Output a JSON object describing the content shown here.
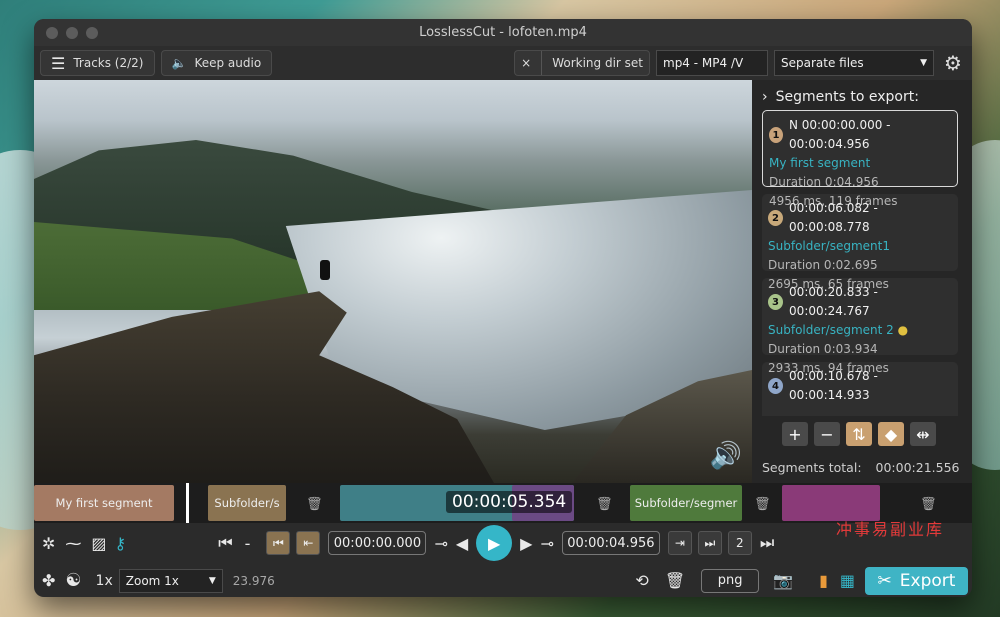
{
  "window": {
    "title": "LosslessCut - lofoten.mp4"
  },
  "topbar": {
    "tracks_label": "Tracks (2/2)",
    "keep_audio_label": "Keep audio",
    "working_dir_label": "Working dir set",
    "close_glyph": "×",
    "format_value": "mp4 - MP4 /V",
    "mode_value": "Separate files"
  },
  "panel": {
    "header": "Segments to export:",
    "segments": [
      {
        "num": "1",
        "range": "N 00:00:00.000 - 00:00:04.956",
        "name": "My first segment",
        "duration": "Duration 0:04.956",
        "frames": "4956 ms, 119 frames",
        "color": "#c8a27a",
        "selected": true
      },
      {
        "num": "2",
        "range": "00:00:06.082 - 00:00:08.778",
        "name": "Subfolder/segment1",
        "duration": "Duration 0:02.695",
        "frames": "2695 ms, 65 frames",
        "color": "#c8a97a",
        "selected": false
      },
      {
        "num": "3",
        "range": "00:00:20.833 - 00:00:24.767",
        "name": "Subfolder/segment 2",
        "duration": "Duration 0:03.934",
        "frames": "2933 ms, 94 frames",
        "color": "#a9c48a",
        "selected": false
      },
      {
        "num": "4",
        "range": "00:00:10.678 - 00:00:14.933",
        "name": "",
        "duration": "",
        "frames": "",
        "color": "#8fa6c9",
        "selected": false
      }
    ],
    "total_label": "Segments total:",
    "total_value": "00:00:21.556"
  },
  "timeline": {
    "current_time": "00:00:05.354",
    "segments": [
      {
        "label": "My first segment",
        "color": "#a47a63",
        "index": "1"
      },
      {
        "label": "Subfolder/s",
        "color": "#8a7351",
        "index": "2"
      },
      {
        "label": "",
        "color": "#3f7f87",
        "index": "3"
      },
      {
        "label": "",
        "color": "#6b4a84",
        "index": "4"
      },
      {
        "label": "Subfolder/segmer",
        "color": "#4f7a3c",
        "index": "5"
      },
      {
        "label": "",
        "color": "#8a3a78",
        "index": "6"
      }
    ]
  },
  "controls": {
    "start_time": "00:00:00.000",
    "end_time": "00:00:04.956",
    "segment_nav_num": "2",
    "minus": "-"
  },
  "bottom": {
    "speed": "1x",
    "zoom_value": "Zoom 1x",
    "fps": "23.976",
    "capture_format": "png",
    "export_label": "Export"
  },
  "watermark": "冲事易副业库",
  "colors": {
    "accent": "#35b6c8"
  },
  "icons": [
    "hamburger-icon",
    "speaker-icon",
    "gear-icon",
    "chevron-right-icon",
    "plus-icon",
    "minus-icon",
    "sort-icon",
    "tag-icon",
    "split-icon",
    "trash-icon",
    "skip-start-icon",
    "play-icon",
    "key-icon",
    "yin-yang-icon",
    "camera-icon",
    "scissors-icon"
  ]
}
